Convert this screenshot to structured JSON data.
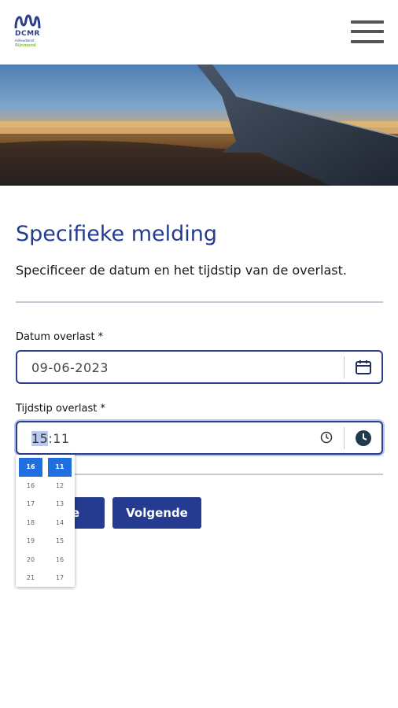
{
  "header": {
    "logo_text": "DCMR",
    "logo_subtitle": "milieudienst",
    "logo_tagline": "Rijnmond"
  },
  "page": {
    "title": "Specifieke melding",
    "subtitle": "Specificeer de datum en het tijdstip van de overlast."
  },
  "date_field": {
    "label": "Datum overlast *",
    "value": "09-06-2023",
    "icon": "calendar-icon"
  },
  "time_field": {
    "label": "Tijdstip overlast *",
    "hours": "15",
    "separator": ":",
    "minutes": "11",
    "clear_icon": "clock-small-icon",
    "picker_icon": "clock-filled-icon"
  },
  "buttons": {
    "back_partial": "e",
    "next": "Volgende"
  },
  "time_picker": {
    "hours": [
      "16",
      "16",
      "17",
      "18",
      "19",
      "20",
      "21"
    ],
    "minutes": [
      "11",
      "12",
      "13",
      "14",
      "15",
      "16",
      "17"
    ]
  },
  "colors": {
    "primary": "#243b8f",
    "selection": "#1f6fe0",
    "divider": "#c5c9d6"
  }
}
